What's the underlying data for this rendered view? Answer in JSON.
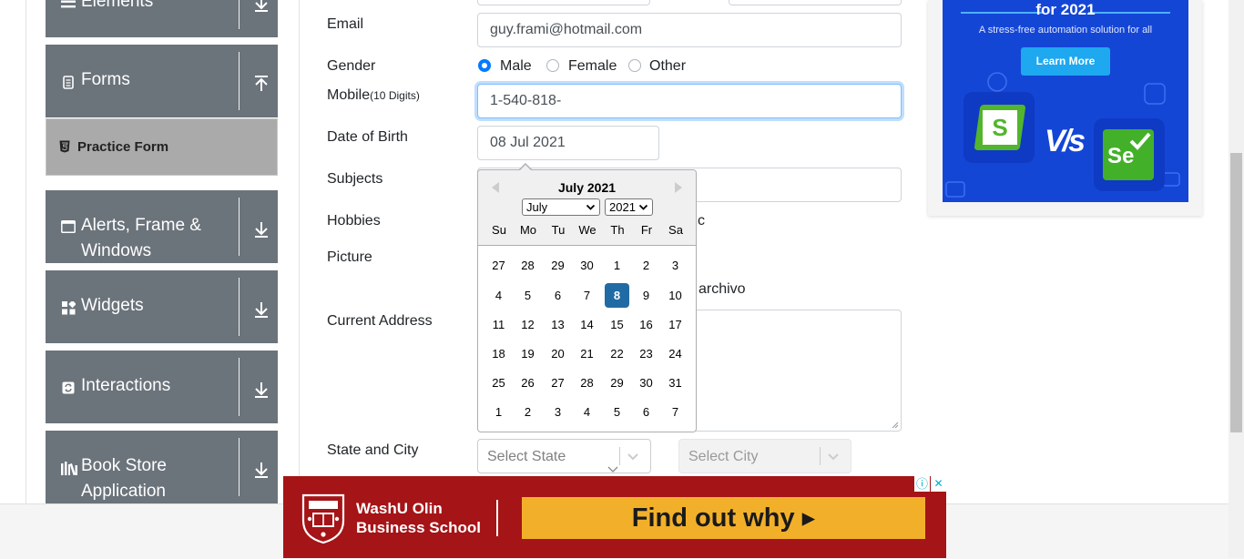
{
  "sidebar": {
    "elements_label": "Elements",
    "forms_label": "Forms",
    "practice_form_label": "Practice Form",
    "alerts_label_line1": "Alerts, Frame &",
    "alerts_label_line2": "Windows",
    "widgets_label": "Widgets",
    "interactions_label": "Interactions",
    "bookstore_label_line1": "Book Store",
    "bookstore_label_line2": "Application"
  },
  "form": {
    "email_label": "Email",
    "email_value": "guy.frami@hotmail.com",
    "gender_label": "Gender",
    "gender_options": [
      "Male",
      "Female",
      "Other"
    ],
    "gender_selected": "Male",
    "mobile_label": "Mobile",
    "mobile_hint": "(10 Digits)",
    "mobile_value": "1-540-818-",
    "dob_label": "Date of Birth",
    "dob_value": "08 Jul 2021",
    "subjects_label": "Subjects",
    "hobbies_label": "Hobbies",
    "hobbies_partial": "c",
    "picture_label": "Picture",
    "picture_partial": "archivo",
    "address_label": "Current Address",
    "state_city_label": "State and City",
    "state_placeholder": "Select State",
    "city_placeholder": "Select City"
  },
  "datepicker": {
    "title": "July 2021",
    "month_select": "July",
    "year_select": "2021",
    "day_names": [
      "Su",
      "Mo",
      "Tu",
      "We",
      "Th",
      "Fr",
      "Sa"
    ],
    "weeks": [
      [
        "27",
        "28",
        "29",
        "30",
        "1",
        "2",
        "3"
      ],
      [
        "4",
        "5",
        "6",
        "7",
        "8",
        "9",
        "10"
      ],
      [
        "11",
        "12",
        "13",
        "14",
        "15",
        "16",
        "17"
      ],
      [
        "18",
        "19",
        "20",
        "21",
        "22",
        "23",
        "24"
      ],
      [
        "25",
        "26",
        "27",
        "28",
        "29",
        "30",
        "31"
      ],
      [
        "1",
        "2",
        "3",
        "4",
        "5",
        "6",
        "7"
      ]
    ],
    "selected_day": "8"
  },
  "ad_right": {
    "headline": "for 2021",
    "subtext": "A stress-free automation solution for all",
    "cta": "Learn More",
    "vs": "V/s",
    "left_logo_letter": "S",
    "right_logo_text": "Se"
  },
  "ad_bottom": {
    "brand_line1": "WashU Olin",
    "brand_line2": "Business School",
    "cta": "Find out why ▸",
    "info_icon": "ⓘ",
    "close_icon": "✕"
  },
  "colors": {
    "sidebar_group": "#6b737b",
    "selected_day": "#216ba5",
    "radio_on": "#007bff",
    "ad_right_bg": "#1446d6",
    "ad_bottom_bg": "#a51417",
    "ad_bottom_cta": "#f2b02a"
  }
}
